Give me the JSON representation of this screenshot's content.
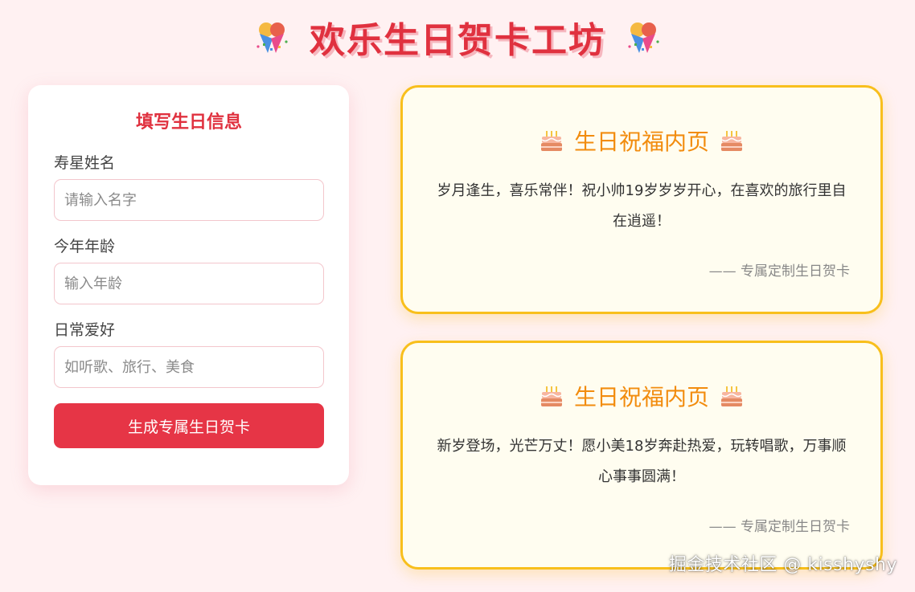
{
  "header": {
    "title": "欢乐生日贺卡工坊",
    "left_icon": "party-popper-icon",
    "right_icon": "party-popper-icon"
  },
  "form": {
    "title": "填写生日信息",
    "fields": [
      {
        "label": "寿星姓名",
        "value": "",
        "placeholder": "请输入名字"
      },
      {
        "label": "今年年龄",
        "value": "",
        "placeholder": "输入年龄"
      },
      {
        "label": "日常爱好",
        "value": "",
        "placeholder": "如听歌、旅行、美食"
      }
    ],
    "submit_label": "生成专属生日贺卡"
  },
  "cards": [
    {
      "title": "生日祝福内页",
      "icon": "birthday-cake-icon",
      "message": "岁月逢生，喜乐常伴！祝小帅19岁岁岁开心，在喜欢的旅行里自在逍遥！",
      "signature": "—— 专属定制生日贺卡"
    },
    {
      "title": "生日祝福内页",
      "icon": "birthday-cake-icon",
      "message": "新岁登场，光芒万丈！愿小美18岁奔赴热爱，玩转唱歌，万事顺心事事圆满！",
      "signature": "—— 专属定制生日贺卡"
    }
  ],
  "watermark": "掘金技术社区 @ kisshyshy",
  "colors": {
    "background": "#fff1f2",
    "primary_red": "#e0313f",
    "button_red": "#e63546",
    "card_border": "#f8bf1c",
    "card_title": "#f28c0e"
  }
}
